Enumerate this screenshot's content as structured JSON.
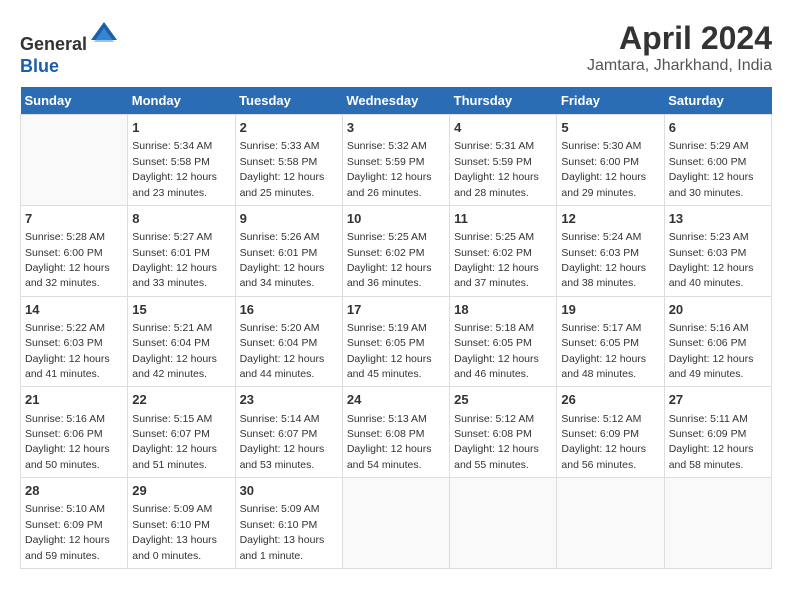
{
  "header": {
    "logo_line1": "General",
    "logo_line2": "Blue",
    "month": "April 2024",
    "location": "Jamtara, Jharkhand, India"
  },
  "weekdays": [
    "Sunday",
    "Monday",
    "Tuesday",
    "Wednesday",
    "Thursday",
    "Friday",
    "Saturday"
  ],
  "weeks": [
    [
      {
        "day": "",
        "info": ""
      },
      {
        "day": "1",
        "info": "Sunrise: 5:34 AM\nSunset: 5:58 PM\nDaylight: 12 hours\nand 23 minutes."
      },
      {
        "day": "2",
        "info": "Sunrise: 5:33 AM\nSunset: 5:58 PM\nDaylight: 12 hours\nand 25 minutes."
      },
      {
        "day": "3",
        "info": "Sunrise: 5:32 AM\nSunset: 5:59 PM\nDaylight: 12 hours\nand 26 minutes."
      },
      {
        "day": "4",
        "info": "Sunrise: 5:31 AM\nSunset: 5:59 PM\nDaylight: 12 hours\nand 28 minutes."
      },
      {
        "day": "5",
        "info": "Sunrise: 5:30 AM\nSunset: 6:00 PM\nDaylight: 12 hours\nand 29 minutes."
      },
      {
        "day": "6",
        "info": "Sunrise: 5:29 AM\nSunset: 6:00 PM\nDaylight: 12 hours\nand 30 minutes."
      }
    ],
    [
      {
        "day": "7",
        "info": "Sunrise: 5:28 AM\nSunset: 6:00 PM\nDaylight: 12 hours\nand 32 minutes."
      },
      {
        "day": "8",
        "info": "Sunrise: 5:27 AM\nSunset: 6:01 PM\nDaylight: 12 hours\nand 33 minutes."
      },
      {
        "day": "9",
        "info": "Sunrise: 5:26 AM\nSunset: 6:01 PM\nDaylight: 12 hours\nand 34 minutes."
      },
      {
        "day": "10",
        "info": "Sunrise: 5:25 AM\nSunset: 6:02 PM\nDaylight: 12 hours\nand 36 minutes."
      },
      {
        "day": "11",
        "info": "Sunrise: 5:25 AM\nSunset: 6:02 PM\nDaylight: 12 hours\nand 37 minutes."
      },
      {
        "day": "12",
        "info": "Sunrise: 5:24 AM\nSunset: 6:03 PM\nDaylight: 12 hours\nand 38 minutes."
      },
      {
        "day": "13",
        "info": "Sunrise: 5:23 AM\nSunset: 6:03 PM\nDaylight: 12 hours\nand 40 minutes."
      }
    ],
    [
      {
        "day": "14",
        "info": "Sunrise: 5:22 AM\nSunset: 6:03 PM\nDaylight: 12 hours\nand 41 minutes."
      },
      {
        "day": "15",
        "info": "Sunrise: 5:21 AM\nSunset: 6:04 PM\nDaylight: 12 hours\nand 42 minutes."
      },
      {
        "day": "16",
        "info": "Sunrise: 5:20 AM\nSunset: 6:04 PM\nDaylight: 12 hours\nand 44 minutes."
      },
      {
        "day": "17",
        "info": "Sunrise: 5:19 AM\nSunset: 6:05 PM\nDaylight: 12 hours\nand 45 minutes."
      },
      {
        "day": "18",
        "info": "Sunrise: 5:18 AM\nSunset: 6:05 PM\nDaylight: 12 hours\nand 46 minutes."
      },
      {
        "day": "19",
        "info": "Sunrise: 5:17 AM\nSunset: 6:05 PM\nDaylight: 12 hours\nand 48 minutes."
      },
      {
        "day": "20",
        "info": "Sunrise: 5:16 AM\nSunset: 6:06 PM\nDaylight: 12 hours\nand 49 minutes."
      }
    ],
    [
      {
        "day": "21",
        "info": "Sunrise: 5:16 AM\nSunset: 6:06 PM\nDaylight: 12 hours\nand 50 minutes."
      },
      {
        "day": "22",
        "info": "Sunrise: 5:15 AM\nSunset: 6:07 PM\nDaylight: 12 hours\nand 51 minutes."
      },
      {
        "day": "23",
        "info": "Sunrise: 5:14 AM\nSunset: 6:07 PM\nDaylight: 12 hours\nand 53 minutes."
      },
      {
        "day": "24",
        "info": "Sunrise: 5:13 AM\nSunset: 6:08 PM\nDaylight: 12 hours\nand 54 minutes."
      },
      {
        "day": "25",
        "info": "Sunrise: 5:12 AM\nSunset: 6:08 PM\nDaylight: 12 hours\nand 55 minutes."
      },
      {
        "day": "26",
        "info": "Sunrise: 5:12 AM\nSunset: 6:09 PM\nDaylight: 12 hours\nand 56 minutes."
      },
      {
        "day": "27",
        "info": "Sunrise: 5:11 AM\nSunset: 6:09 PM\nDaylight: 12 hours\nand 58 minutes."
      }
    ],
    [
      {
        "day": "28",
        "info": "Sunrise: 5:10 AM\nSunset: 6:09 PM\nDaylight: 12 hours\nand 59 minutes."
      },
      {
        "day": "29",
        "info": "Sunrise: 5:09 AM\nSunset: 6:10 PM\nDaylight: 13 hours\nand 0 minutes."
      },
      {
        "day": "30",
        "info": "Sunrise: 5:09 AM\nSunset: 6:10 PM\nDaylight: 13 hours\nand 1 minute."
      },
      {
        "day": "",
        "info": ""
      },
      {
        "day": "",
        "info": ""
      },
      {
        "day": "",
        "info": ""
      },
      {
        "day": "",
        "info": ""
      }
    ]
  ]
}
